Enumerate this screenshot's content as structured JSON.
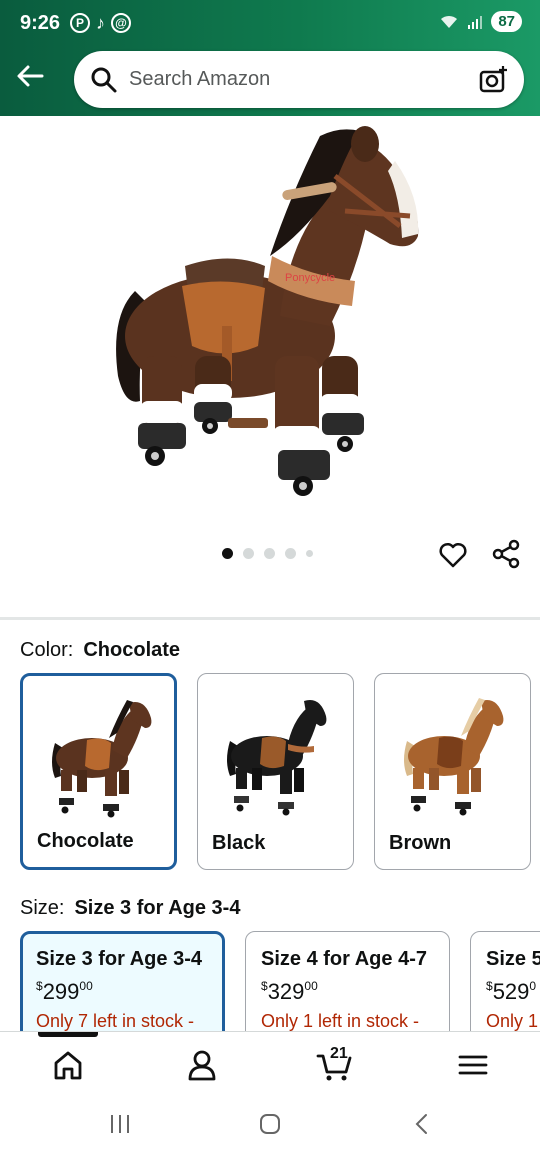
{
  "status_bar": {
    "time": "9:26",
    "battery": "87"
  },
  "search": {
    "placeholder": "Search Amazon"
  },
  "gallery": {
    "dot_count": 5,
    "active_index": 0
  },
  "color": {
    "label": "Color:",
    "selected": "Chocolate",
    "options": [
      "Chocolate",
      "Black",
      "Brown"
    ]
  },
  "size": {
    "label": "Size:",
    "selected": "Size 3 for Age 3-4",
    "options": [
      {
        "name": "Size 3 for Age 3-4",
        "dollars": "299",
        "cents": "00",
        "stock": "Only 7 left in stock -"
      },
      {
        "name": "Size 4 for Age 4-7",
        "dollars": "329",
        "cents": "00",
        "stock": "Only 1 left in stock -"
      },
      {
        "name": "Size 5",
        "dollars": "529",
        "cents": "0",
        "stock": "Only 1"
      }
    ]
  },
  "bottom_nav": {
    "cart_count": "21"
  },
  "colors": {
    "header_green": "#0f7a4e",
    "selected_border": "#1f5e9c",
    "stock_red": "#b12704"
  }
}
